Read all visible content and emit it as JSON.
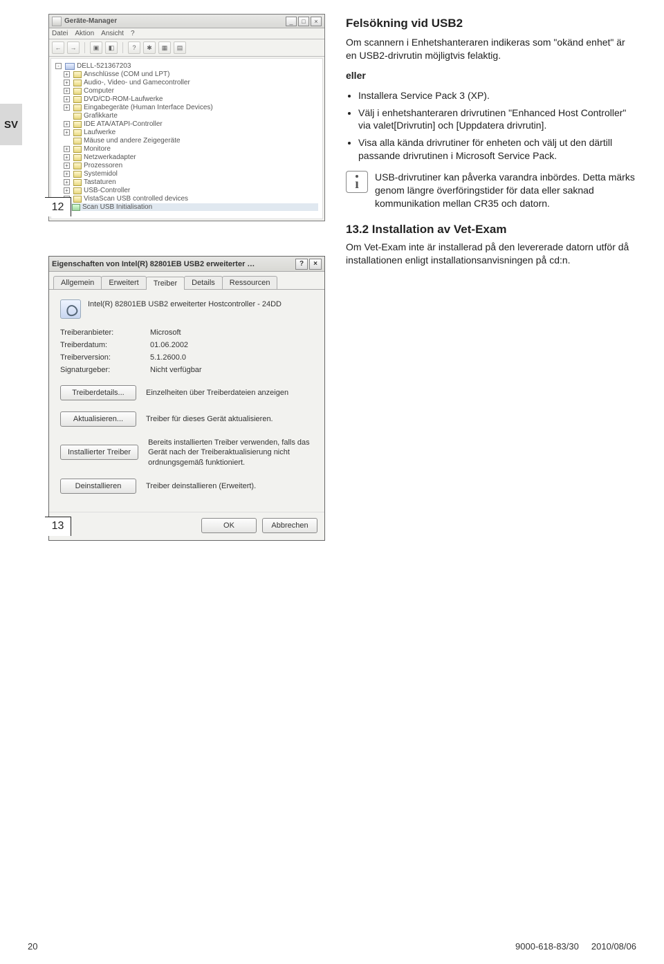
{
  "lang_tab": "SV",
  "footer": {
    "page": "20",
    "docnum": "9000-618-83/30",
    "date": "2010/08/06"
  },
  "section": {
    "title": "Felsökning vid USB2",
    "intro": "Om scannern i Enhetshanteraren indikeras som \"okänd enhet\" är en USB2-drivrutin möjligtvis felaktig.",
    "eller": "eller",
    "bullets": [
      "Installera Service Pack 3 (XP).",
      "Välj i enhetshanteraren drivrutinen \"Enhanced Host Controller\" via valet[Drivrutin] och [Uppdatera drivrutin].",
      "Visa alla kända drivrutiner för enheten och välj ut den därtill passande drivrutinen i Microsoft Service Pack."
    ],
    "info": "USB-drivrutiner kan påverka varandra inbördes. Detta märks genom längre överföringstider för data eller saknad kommunikation mellan CR35 och datorn.",
    "sub_title": "13.2 Installation av Vet-Exam",
    "sub_body": "Om Vet-Exam inte är installerad på den levererade datorn utför då installationen enligt installationsanvisningen på cd:n."
  },
  "devmgr": {
    "title": "Geräte-Manager",
    "menus": [
      "Datei",
      "Aktion",
      "Ansicht",
      "?"
    ],
    "root": "DELL-521367203",
    "nodes": [
      {
        "exp": "+",
        "label": "Anschlüsse (COM und LPT)"
      },
      {
        "exp": "+",
        "label": "Audio-, Video- und Gamecontroller"
      },
      {
        "exp": "+",
        "label": "Computer"
      },
      {
        "exp": "+",
        "label": "DVD/CD-ROM-Laufwerke"
      },
      {
        "exp": "+",
        "label": "Eingabegeräte (Human Interface Devices)"
      },
      {
        "exp": "",
        "label": "Grafikkarte"
      },
      {
        "exp": "+",
        "label": "IDE ATA/ATAPI-Controller"
      },
      {
        "exp": "+",
        "label": "Laufwerke"
      },
      {
        "exp": "",
        "label": "Mäuse und andere Zeigegeräte"
      },
      {
        "exp": "+",
        "label": "Monitore"
      },
      {
        "exp": "+",
        "label": "Netzwerkadapter"
      },
      {
        "exp": "+",
        "label": "Prozessoren"
      },
      {
        "exp": "+",
        "label": "Systemidol"
      },
      {
        "exp": "+",
        "label": "Tastaturen"
      },
      {
        "exp": "+",
        "label": "USB-Controller"
      },
      {
        "exp": "-",
        "label": "VistaScan USB controlled devices"
      }
    ],
    "selected_child": "Scan USB Initialisation",
    "figure": "12"
  },
  "dlg": {
    "title": "Eigenschaften von Intel(R) 82801EB USB2 erweiterter …",
    "tabs": [
      "Allgemein",
      "Erweitert",
      "Treiber",
      "Details",
      "Ressourcen"
    ],
    "active_tab": 2,
    "device": "Intel(R) 82801EB USB2 erweiterter Hostcontroller - 24DD",
    "rows": [
      {
        "k": "Treiberanbieter:",
        "v": "Microsoft"
      },
      {
        "k": "Treiberdatum:",
        "v": "01.06.2002"
      },
      {
        "k": "Treiberversion:",
        "v": "5.1.2600.0"
      },
      {
        "k": "Signaturgeber:",
        "v": "Nicht verfügbar"
      }
    ],
    "actions": [
      {
        "btn": "Treiberdetails...",
        "desc": "Einzelheiten über Treiberdateien anzeigen"
      },
      {
        "btn": "Aktualisieren...",
        "desc": "Treiber für dieses Gerät aktualisieren."
      },
      {
        "btn": "Installierter Treiber",
        "desc": "Bereits installierten Treiber verwenden, falls das Gerät nach der Treiberaktualisierung nicht ordnungsgemäß funktioniert."
      },
      {
        "btn": "Deinstallieren",
        "desc": "Treiber deinstallieren (Erweitert)."
      }
    ],
    "ok": "OK",
    "cancel": "Abbrechen",
    "figure": "13"
  }
}
